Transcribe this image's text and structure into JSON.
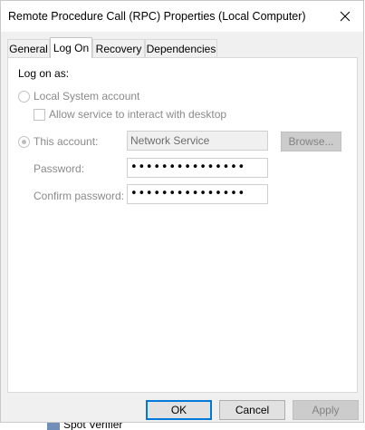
{
  "window": {
    "title": "Remote Procedure Call (RPC) Properties (Local Computer)"
  },
  "tabs": [
    {
      "label": "General",
      "active": false
    },
    {
      "label": "Log On",
      "active": true
    },
    {
      "label": "Recovery",
      "active": false
    },
    {
      "label": "Dependencies",
      "active": false
    }
  ],
  "logon": {
    "heading": "Log on as:",
    "local_system_label": "Local System account",
    "interact_desktop_label": "Allow service to interact with desktop",
    "interact_desktop_checked": false,
    "this_account_label": "This account:",
    "this_account_selected": true,
    "account_value": "Network Service",
    "browse_label": "Browse...",
    "password_label": "Password:",
    "password_value": "•••••••••••••••",
    "confirm_password_label": "Confirm password:",
    "confirm_password_value": "•••••••••••••••"
  },
  "footer": {
    "ok_label": "OK",
    "cancel_label": "Cancel",
    "apply_label": "Apply"
  },
  "background": {
    "partial_item_label": "Spot Verifier"
  },
  "colors": {
    "dialog_bg": "#f0f0f0",
    "panel_bg": "#ffffff",
    "default_button_border": "#0078d7",
    "disabled_text": "#8a8a8a"
  }
}
